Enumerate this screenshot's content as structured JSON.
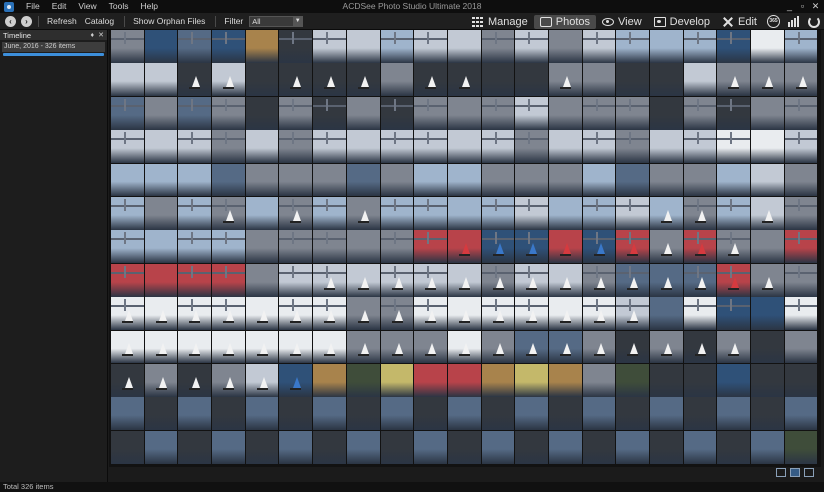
{
  "app": {
    "title": "ACDSee Photo Studio Ultimate 2018"
  },
  "menu": {
    "items": [
      "File",
      "Edit",
      "View",
      "Tools",
      "Help"
    ]
  },
  "window_controls": {
    "minimize": "_",
    "maximize": "▫",
    "close": "✕"
  },
  "toolbar": {
    "back": "‹",
    "forward": "›",
    "refresh": "Refresh",
    "catalog": "Catalog",
    "show_orphan": "Show Orphan Files",
    "filter_label": "Filter",
    "filter_value": "All"
  },
  "modes": {
    "manage": "Manage",
    "photos": "Photos",
    "view": "View",
    "develop": "Develop",
    "edit": "Edit",
    "active": "Photos"
  },
  "extra_icons": {
    "badge": "365"
  },
  "sidebar": {
    "pane_title": "Timeline",
    "pin": "♦",
    "close": "✕",
    "group_label": "June, 2016 - 326 items"
  },
  "thumbnails": {
    "palette": {
      "c": "#c2c9d4",
      "s": "#9fb4cc",
      "w": "#556a85",
      "d": "#33383f",
      "g": "#7f8590",
      "l": "#e9ecef",
      "b": "#2f5178",
      "r": "#b8434a",
      "o": "#a8834c",
      "t": "#3f4d3a",
      "y": "#c4b86a"
    },
    "rows": [
      "gbwbodccsccgcgcsssbls",
      "ccdcddddgddddggddcggg",
      "wgwgdgdgdgggcgggdgdgg",
      "cccgcgccccccgccgccllc",
      "ssswgggwgssgggswggscg",
      "sgsgsgsgsssscsscsgscg",
      "ssssgggggrrbbrbrgrggr",
      "rrrrgccccccgccgwwwrgg",
      "lllllllggllllllcwlbbl",
      "lllllllggglgwwgdgdgdg",
      "dgdgcbotyrroyogtddbdd",
      "wdwdwdwdwdwdwdwdwdwdw",
      "dwdwdwdwdwdwdwdwdwdwt"
    ],
    "sail_cells": [
      [
        1,
        2
      ],
      [
        1,
        3
      ],
      [
        1,
        5
      ],
      [
        1,
        6
      ],
      [
        1,
        7
      ],
      [
        1,
        9
      ],
      [
        1,
        10
      ],
      [
        1,
        13
      ],
      [
        1,
        18
      ],
      [
        1,
        19
      ],
      [
        1,
        20
      ],
      [
        5,
        3
      ],
      [
        5,
        5
      ],
      [
        5,
        7
      ],
      [
        5,
        16
      ],
      [
        5,
        17
      ],
      [
        5,
        19
      ],
      [
        6,
        10
      ],
      [
        6,
        11
      ],
      [
        6,
        12
      ],
      [
        6,
        13
      ],
      [
        6,
        14
      ],
      [
        6,
        15
      ],
      [
        6,
        16
      ],
      [
        6,
        17
      ],
      [
        6,
        18
      ],
      [
        7,
        6
      ],
      [
        7,
        7
      ],
      [
        7,
        8
      ],
      [
        7,
        9
      ],
      [
        7,
        10
      ],
      [
        7,
        11
      ],
      [
        7,
        12
      ],
      [
        7,
        13
      ],
      [
        7,
        14
      ],
      [
        7,
        15
      ],
      [
        7,
        16
      ],
      [
        7,
        17
      ],
      [
        7,
        18
      ],
      [
        7,
        19
      ],
      [
        8,
        0
      ],
      [
        8,
        1
      ],
      [
        8,
        2
      ],
      [
        8,
        3
      ],
      [
        8,
        4
      ],
      [
        8,
        5
      ],
      [
        8,
        6
      ],
      [
        8,
        7
      ],
      [
        8,
        8
      ],
      [
        8,
        9
      ],
      [
        8,
        10
      ],
      [
        8,
        11
      ],
      [
        8,
        12
      ],
      [
        8,
        13
      ],
      [
        8,
        14
      ],
      [
        8,
        15
      ],
      [
        9,
        0
      ],
      [
        9,
        1
      ],
      [
        9,
        2
      ],
      [
        9,
        3
      ],
      [
        9,
        4
      ],
      [
        9,
        5
      ],
      [
        9,
        6
      ],
      [
        9,
        7
      ],
      [
        9,
        8
      ],
      [
        9,
        9
      ],
      [
        9,
        10
      ],
      [
        9,
        11
      ],
      [
        9,
        12
      ],
      [
        9,
        13
      ],
      [
        9,
        14
      ],
      [
        9,
        15
      ],
      [
        9,
        16
      ],
      [
        9,
        17
      ],
      [
        9,
        18
      ],
      [
        10,
        0
      ],
      [
        10,
        1
      ],
      [
        10,
        2
      ],
      [
        10,
        3
      ],
      [
        10,
        4
      ],
      [
        10,
        5
      ]
    ],
    "bridge_rows": [
      0,
      2,
      3,
      5,
      6,
      7,
      8
    ]
  },
  "status": {
    "text": "Total 326 items"
  }
}
